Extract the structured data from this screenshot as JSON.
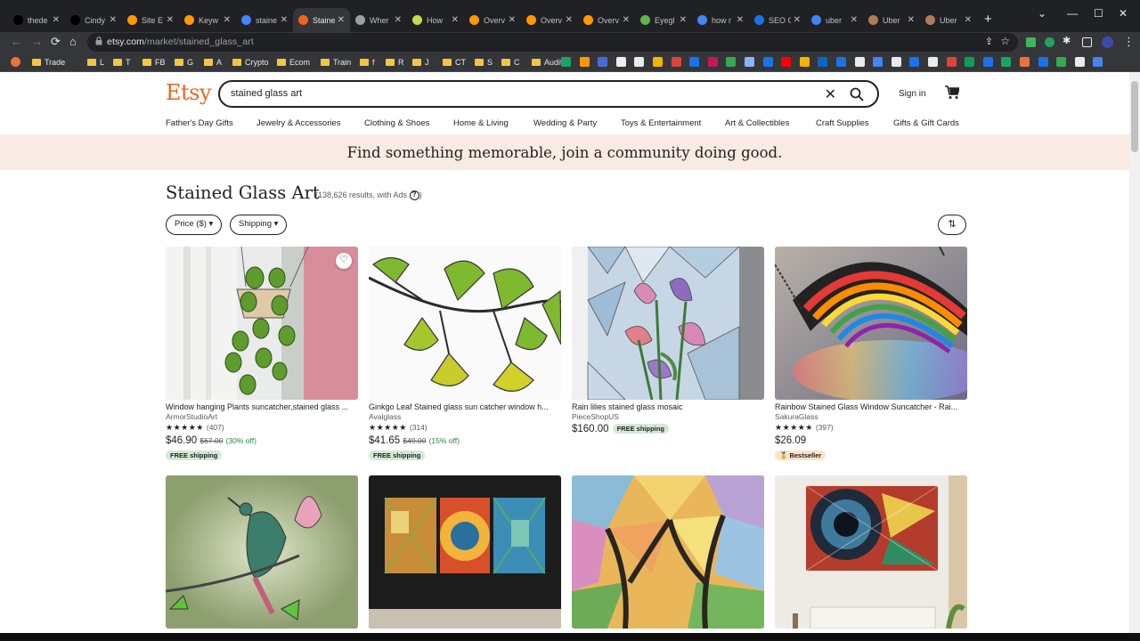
{
  "browser": {
    "tabs": [
      {
        "label": "thede",
        "icon": "tiktok-icon",
        "color": "#000000"
      },
      {
        "label": "Cindy",
        "icon": "tiktok-icon",
        "color": "#000000"
      },
      {
        "label": "Site E",
        "icon": "amazon-icon",
        "color": "#ff9900"
      },
      {
        "label": "Keyw",
        "icon": "amazon-icon",
        "color": "#ff9900"
      },
      {
        "label": "staine",
        "icon": "google-icon",
        "color": "#4285f4"
      },
      {
        "label": "Staine",
        "icon": "etsy-icon",
        "color": "#f1641e",
        "active": true
      },
      {
        "label": "Wher",
        "icon": "globe-icon",
        "color": "#9aa0a6"
      },
      {
        "label": "How",
        "icon": "page-icon",
        "color": "#c6d94a"
      },
      {
        "label": "Overv",
        "icon": "amazon-icon",
        "color": "#ff9900"
      },
      {
        "label": "Overv",
        "icon": "amazon-icon",
        "color": "#ff9900"
      },
      {
        "label": "Overv",
        "icon": "amazon-icon",
        "color": "#ff9900"
      },
      {
        "label": "Eyegl",
        "icon": "shopify-icon",
        "color": "#5eb546"
      },
      {
        "label": "how r",
        "icon": "google-icon",
        "color": "#4285f4"
      },
      {
        "label": "SEO C",
        "icon": "seo-icon",
        "color": "#1a73e8"
      },
      {
        "label": "uber",
        "icon": "google-icon",
        "color": "#4285f4"
      },
      {
        "label": "Uber",
        "icon": "avatar-icon",
        "color": "#b07b5a"
      },
      {
        "label": "Uber",
        "icon": "avatar-icon",
        "color": "#b07b5a"
      }
    ],
    "url_host": "etsy.com",
    "url_path": "/market/stained_glass_art",
    "bookmarks": [
      "Trade",
      "L",
      "T",
      "FB",
      "G",
      "A",
      "Crypto",
      "Ecom",
      "Train",
      "f",
      "R",
      "J",
      "CT",
      "S",
      "C",
      "Audit"
    ]
  },
  "header": {
    "logo": "Etsy",
    "search_value": "stained glass art",
    "signin": "Sign in"
  },
  "categories": [
    "Father's Day Gifts",
    "Jewelry & Accessories",
    "Clothing & Shoes",
    "Home & Living",
    "Wedding & Party",
    "Toys & Entertainment",
    "Art & Collectibles",
    "Craft Supplies",
    "Gifts & Gift Cards"
  ],
  "banner": "Find something memorable, join a community doing good.",
  "results": {
    "title": "Stained Glass Art",
    "count_text": "(138,626 results, with Ads",
    "help": "?"
  },
  "filters": {
    "price": "Price ($) ▾",
    "shipping": "Shipping ▾",
    "sort_icon": "⇅"
  },
  "listings": [
    {
      "title": "Window hanging Plants suncatcher,stained glass ...",
      "shop": "ArmorStudioArt",
      "stars": "★★★★★",
      "reviews": "(407)",
      "price": "$46.90",
      "orig": "$67.00",
      "disc": "(30% off)",
      "badge": "FREE shipping"
    },
    {
      "title": "Ginkgo Leaf Stained glass sun catcher window h...",
      "shop": "Avalglass",
      "stars": "★★★★★",
      "reviews": "(314)",
      "price": "$41.65",
      "orig": "$49.00",
      "disc": "(15% off)",
      "badge": "FREE shipping"
    },
    {
      "title": "Rain lilies stained glass mosaic",
      "shop": "PieceShopUS",
      "stars": "",
      "reviews": "",
      "price": "$160.00",
      "orig": "",
      "disc": "",
      "badge": "FREE shipping"
    },
    {
      "title": "Rainbow Stained Glass Window Suncatcher - Rai...",
      "shop": "SakuraGlass",
      "stars": "★★★★★",
      "reviews": "(397)",
      "price": "$26.09",
      "orig": "",
      "disc": "",
      "badge": "Bestseller"
    }
  ]
}
